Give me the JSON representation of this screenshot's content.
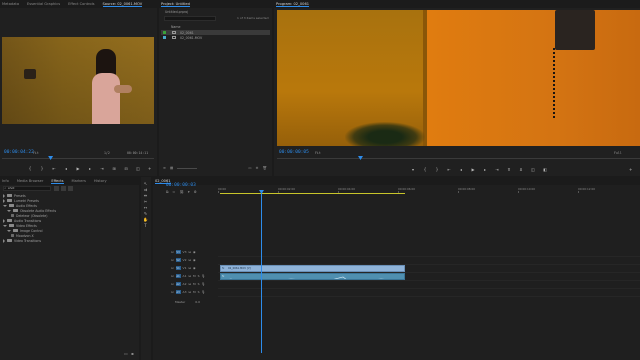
{
  "source_monitor": {
    "tabs": [
      "Metadata",
      "Essential Graphics",
      "Effect Controls",
      "Source: 02_0061.MOV"
    ],
    "active_tab": 3,
    "timecode": "00:00:04:22",
    "fit": "Fit",
    "resolution": "1/2",
    "duration": "00:00:14:11",
    "playhead_pct": 32
  },
  "project_panel": {
    "title": "Project: Untitled",
    "filename": "Untitled.prproj",
    "items_selected": "1 of 3 items selected",
    "name_header": "Name",
    "items": [
      {
        "name": "02_0061",
        "type": "sequence",
        "color": "#3aa23a",
        "selected": true
      },
      {
        "name": "02_0061.MOV",
        "type": "clip",
        "color": "#4aa8c8",
        "selected": false
      }
    ]
  },
  "program_monitor": {
    "tab": "Program: 02_0061",
    "timecode": "00:00:00:05",
    "fit": "Fit",
    "resolution": "Full",
    "playhead_pct": 23
  },
  "effects_panel": {
    "tabs": [
      "Info",
      "Media Browser",
      "Effects",
      "Markers",
      "History"
    ],
    "active_tab": 2,
    "search_value": "shot",
    "tree": [
      {
        "label": "Presets",
        "depth": 0,
        "open": false
      },
      {
        "label": "Lumetri Presets",
        "depth": 0,
        "open": false
      },
      {
        "label": "Audio Effects",
        "depth": 0,
        "open": true
      },
      {
        "label": "Obsolete Audio Effects",
        "depth": 1,
        "open": true
      },
      {
        "label": "Deleteor (Obsolete)",
        "depth": 2,
        "open": false,
        "leaf": true
      },
      {
        "label": "Audio Transitions",
        "depth": 0,
        "open": false
      },
      {
        "label": "Video Effects",
        "depth": 0,
        "open": true
      },
      {
        "label": "Image Control",
        "depth": 1,
        "open": true
      },
      {
        "label": "Moodvon X",
        "depth": 2,
        "open": false,
        "leaf": true
      },
      {
        "label": "Video Transitions",
        "depth": 0,
        "open": false
      }
    ]
  },
  "timeline": {
    "tab": "02_0061",
    "timecode": "00:00:00:03",
    "ruler": [
      "00:00",
      "00:00:02:00",
      "00:00:04:00",
      "00:00:06:00",
      "00:00:08:00",
      "00:00:10:00",
      "00:00:12:00"
    ],
    "video_tracks": [
      "V3",
      "V2",
      "V1"
    ],
    "audio_tracks": [
      "A1",
      "A2",
      "A3"
    ],
    "master_label": "Master",
    "master_value": "0.0",
    "clip_label": "02_0061.MOV [V]",
    "colors": {
      "video_clip": "#8fb3d9",
      "audio_clip": "#4f8fb0",
      "playhead": "#2d8ceb",
      "work_area": "#c8c52a"
    }
  }
}
